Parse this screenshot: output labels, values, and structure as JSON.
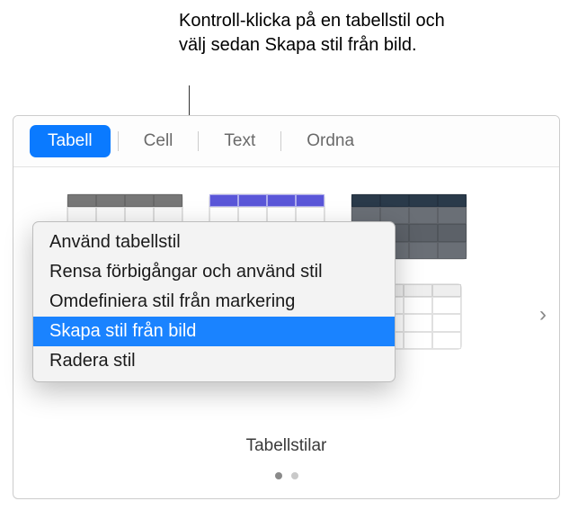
{
  "callout": {
    "text": "Kontroll-klicka på en tabellstil och välj sedan Skapa stil från bild."
  },
  "tabs": {
    "items": [
      {
        "label": "Tabell",
        "active": true
      },
      {
        "label": "Cell",
        "active": false
      },
      {
        "label": "Text",
        "active": false
      },
      {
        "label": "Ordna",
        "active": false
      }
    ]
  },
  "context_menu": {
    "items": [
      {
        "label": "Använd tabellstil",
        "highlight": false
      },
      {
        "label": "Rensa förbigångar och använd stil",
        "highlight": false
      },
      {
        "label": "Omdefiniera stil från markering",
        "highlight": false
      },
      {
        "label": "Skapa stil från bild",
        "highlight": true
      },
      {
        "label": "Radera stil",
        "highlight": false
      }
    ]
  },
  "section": {
    "label": "Tabellstilar"
  },
  "nav": {
    "right_icon": "›"
  }
}
